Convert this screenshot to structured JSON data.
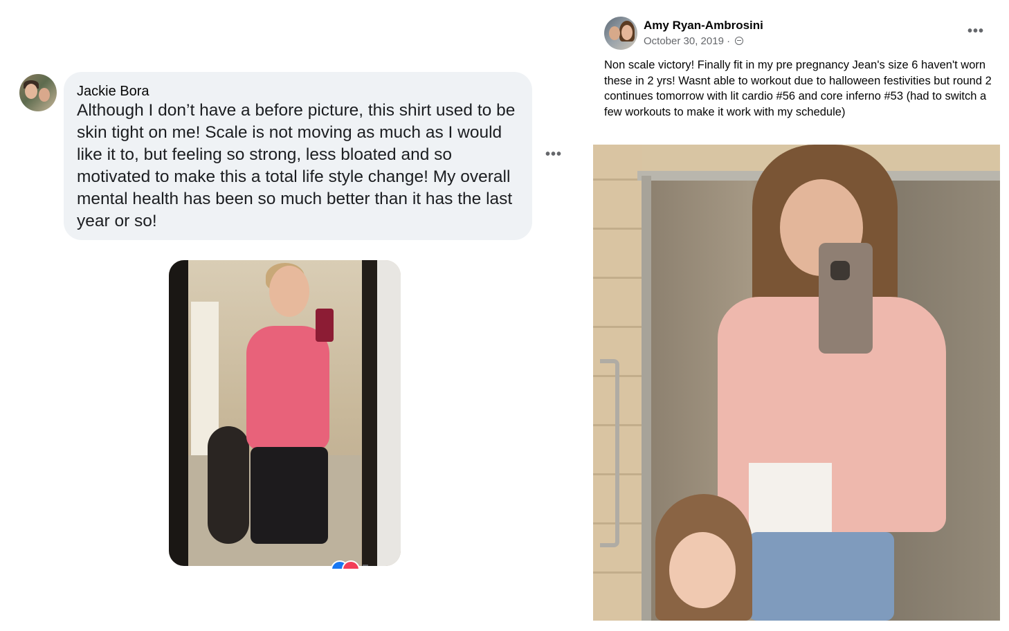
{
  "comment": {
    "author": "Jackie Bora",
    "text": "Although I don’t have a before picture, this shirt used to be skin tight on me! Scale is not moving as much as I would like it to, but feeling so strong, less bloated and so motivated to make this a total life style change! My overall mental health has been so much better than it has the last year or so!",
    "more_icon": "•••",
    "photo_icon": "image",
    "reactions": [
      "like",
      "love"
    ]
  },
  "post": {
    "author": "Amy Ryan-Ambrosini",
    "date": "October 30, 2019 ·",
    "privacy_icon": "globe-icon",
    "more_icon": "•••",
    "text": "Non scale victory! Finally fit in my pre pregnancy Jean's size 6 haven't worn these in 2 yrs! Wasnt able to workout due to halloween festivities but round 2 continues tomorrow with lit cardio #56 and core inferno #53 (had to switch a few workouts to make it work with my schedule)"
  },
  "colors": {
    "bubble_bg": "#eff2f5",
    "meta_text": "#65676b",
    "like_blue": "#1877f2",
    "love_red": "#f33e58"
  }
}
